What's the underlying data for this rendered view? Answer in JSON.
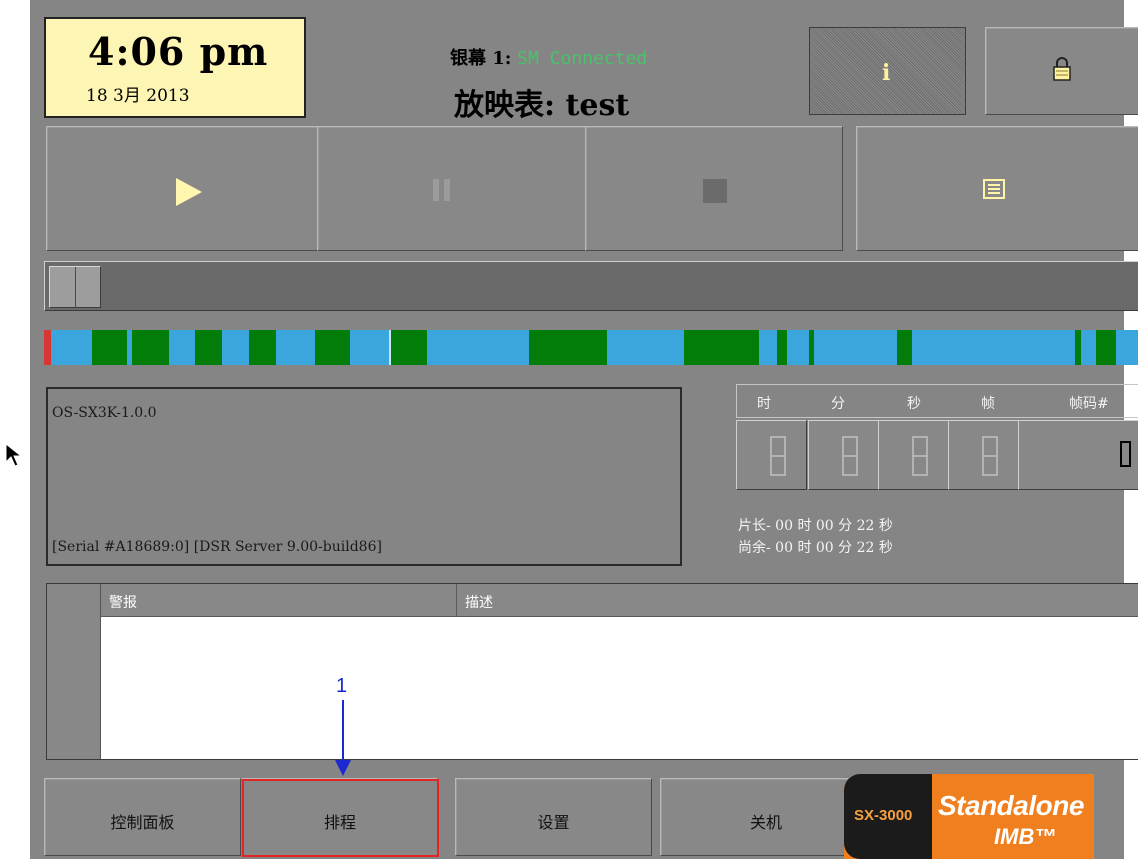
{
  "clock": {
    "time": "4:06 pm",
    "date": "18  3月 2013"
  },
  "header": {
    "screen_label": "银幕 1:",
    "screen_status": "SM Connected",
    "playlist_label": "放映表:",
    "playlist_name": "test"
  },
  "icons": {
    "info": "info-icon",
    "lock": "lock-icon",
    "play": "play-icon",
    "pause": "pause-icon",
    "stop": "stop-icon",
    "playlist": "playlist-icon"
  },
  "progress": {
    "position": 0
  },
  "info_box": {
    "line1": "OS-SX3K-1.0.0",
    "line2": "[Serial #A18689:0] [DSR Server 9.00-build86]"
  },
  "timecode": {
    "headers": [
      "时",
      "分",
      "秒",
      "帧",
      "帧码#"
    ],
    "frame_value": "0"
  },
  "length": {
    "total": "片长- 00 时 00 分 22 秒",
    "remaining": "尚余- 00 时 00 分 22 秒"
  },
  "alarm_table": {
    "columns": [
      "警报",
      "描述"
    ],
    "rows": []
  },
  "nav": {
    "control_panel": "控制面板",
    "schedule": "排程",
    "settings": "设置",
    "shutdown": "关机"
  },
  "logo": {
    "model": "SX-3000",
    "line1": "Standalone",
    "line2": "IMB™"
  },
  "annotation": {
    "label": "1"
  },
  "colors": {
    "panel": "#858585",
    "clock_bg": "#fdf5b4",
    "status_green": "#49c26b",
    "timeline_blue": "#3ba6de",
    "timeline_green": "#037d0a",
    "highlight_red": "#e32424",
    "annotation_blue": "#1a2ad0",
    "logo_orange": "#f0801f"
  }
}
